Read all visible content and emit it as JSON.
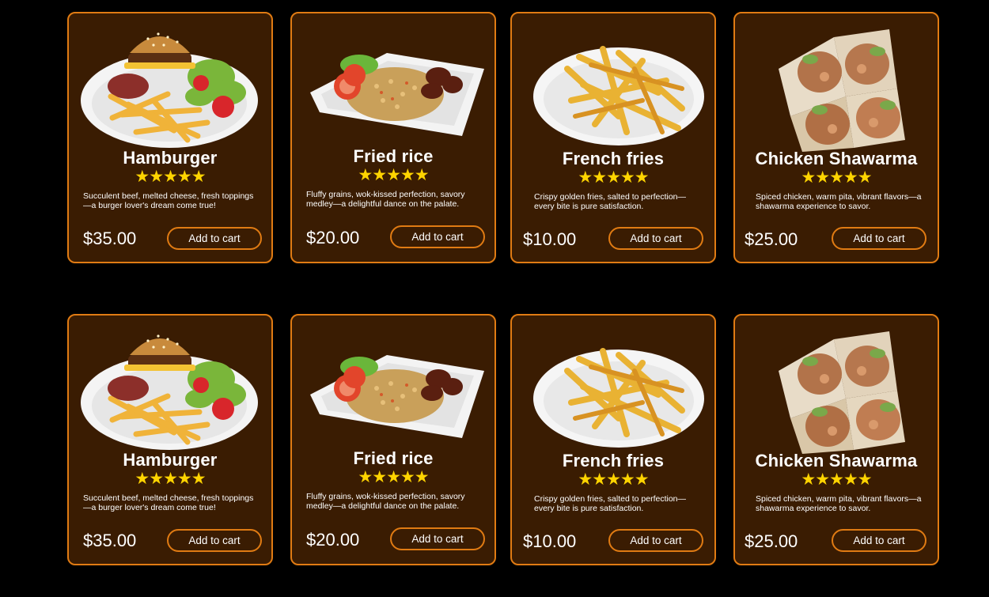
{
  "rows": [
    [
      {
        "name": "Hamburger",
        "rating": "★★★★★",
        "description": "Succulent beef, melted cheese, fresh toppings—a burger lover's dream come true!",
        "price": "$35.00",
        "button_label": "Add to cart",
        "image": "hamburger-with-fries"
      },
      {
        "name": "Fried rice",
        "rating": "★★★★★",
        "description": "Fluffy grains, wok-kissed perfection, savory medley—a delightful dance on the palate.",
        "price": "$20.00",
        "button_label": "Add to cart",
        "image": "fried-rice-plate"
      },
      {
        "name": "French fries",
        "rating": "★★★★★",
        "description": "Crispy golden fries, salted to perfection—every bite is pure satisfaction.",
        "price": "$10.00",
        "button_label": "Add to cart",
        "image": "french-fries-plate"
      },
      {
        "name": "Chicken Shawarma",
        "rating": "★★★★★",
        "description": "Spiced chicken, warm pita, vibrant flavors—a shawarma experience to savor.",
        "price": "$25.00",
        "button_label": "Add to cart",
        "image": "chicken-shawarma-wraps"
      }
    ],
    [
      {
        "name": "Hamburger",
        "rating": "★★★★★",
        "description": "Succulent beef, melted cheese, fresh toppings—a burger lover's dream come true!",
        "price": "$35.00",
        "button_label": "Add to cart",
        "image": "hamburger-with-fries"
      },
      {
        "name": "Fried rice",
        "rating": "★★★★★",
        "description": "Fluffy grains, wok-kissed perfection, savory medley—a delightful dance on the palate.",
        "price": "$20.00",
        "button_label": "Add to cart",
        "image": "fried-rice-plate"
      },
      {
        "name": "French fries",
        "rating": "★★★★★",
        "description": "Crispy golden fries, salted to perfection—every bite is pure satisfaction.",
        "price": "$10.00",
        "button_label": "Add to cart",
        "image": "french-fries-plate"
      },
      {
        "name": "Chicken Shawarma",
        "rating": "★★★★★",
        "description": "Spiced chicken, warm pita, vibrant flavors—a shawarma experience to savor.",
        "price": "$25.00",
        "button_label": "Add to cart",
        "image": "chicken-shawarma-wraps"
      }
    ]
  ],
  "colors": {
    "card_background": "#3a1c02",
    "accent": "#e07b13",
    "stars": "#ffd400",
    "page_background": "#000000"
  }
}
